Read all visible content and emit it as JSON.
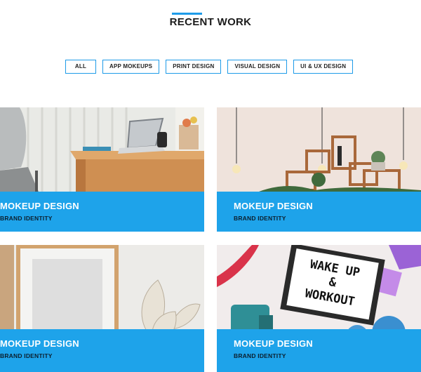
{
  "section": {
    "title": "RECENT WORK"
  },
  "filters": [
    {
      "label": "ALL"
    },
    {
      "label": "APP MOKEUPS"
    },
    {
      "label": "PRINT DESIGN"
    },
    {
      "label": "VISUAL DESIGN"
    },
    {
      "label": "UI & UX DESIGN"
    }
  ],
  "portfolio": [
    {
      "title": "MOKEUP DESIGN",
      "subtitle": "BRAND IDENTITY",
      "image": "office-desk-laptop-photo"
    },
    {
      "title": "MOKEUP DESIGN",
      "subtitle": "BRAND IDENTITY",
      "image": "hanging-bulbs-shelves-photo"
    },
    {
      "title": "MOKEUP DESIGN",
      "subtitle": "BRAND IDENTITY",
      "image": "frame-dried-leaves-photo"
    },
    {
      "title": "MOKEUP DESIGN",
      "subtitle": "BRAND IDENTITY",
      "image": "wake-up-workout-lightbox-photo"
    }
  ],
  "lightbox_text": {
    "line1": "WAKE UP",
    "line2": "&",
    "line3": "WORKOUT"
  },
  "colors": {
    "accent": "#1e9be8",
    "overlay": "#1ea3ea"
  }
}
